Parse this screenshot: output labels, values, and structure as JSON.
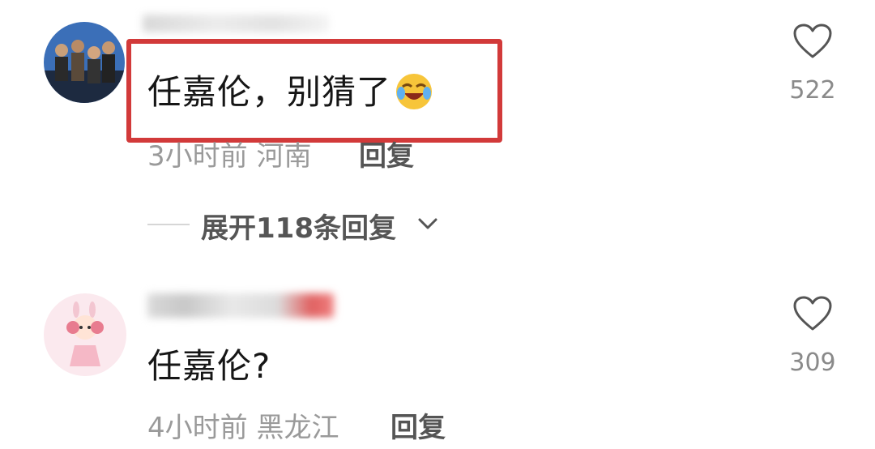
{
  "comments": [
    {
      "text": "任嘉伦，别猜了",
      "emoji": "crying-laughing-emoji",
      "time": "3小时前",
      "location": "河南",
      "reply_label": "回复",
      "like_count": "522",
      "expand_label": "展开118条回复"
    },
    {
      "text": "任嘉伦?",
      "time": "4小时前",
      "location": "黑龙江",
      "reply_label": "回复",
      "like_count": "309"
    }
  ],
  "colors": {
    "highlight": "#d23a3a",
    "meta_text": "#9a9a9a"
  },
  "icons": [
    "heart-outline-icon",
    "chevron-down-icon"
  ]
}
